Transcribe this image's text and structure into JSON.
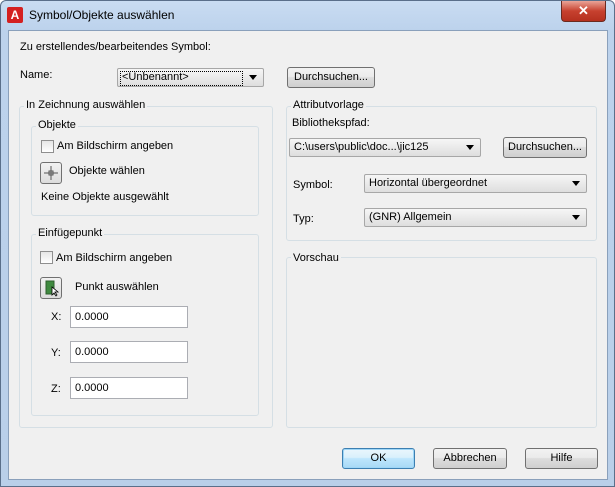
{
  "window": {
    "title": "Symbol/Objekte auswählen",
    "app_icon": "A",
    "close": "✕"
  },
  "top": {
    "symbol_heading": "Zu erstellendes/bearbeitendes Symbol:",
    "name_label": "Name:",
    "name_value": "<Unbenannt>",
    "browse_label": "Durchsuchen..."
  },
  "select_in_drawing": {
    "title": "In Zeichnung auswählen",
    "objects": {
      "title": "Objekte",
      "specify_on_screen": "Am Bildschirm angeben",
      "select_objects": "Objekte wählen",
      "status": "Keine Objekte ausgewählt"
    },
    "insertion_point": {
      "title": "Einfügepunkt",
      "specify_on_screen": "Am Bildschirm angeben",
      "pick_point": "Punkt auswählen",
      "x_label": "X:",
      "x_value": "0.0000",
      "y_label": "Y:",
      "y_value": "0.0000",
      "z_label": "Z:",
      "z_value": "0.0000"
    }
  },
  "attribute_template": {
    "title": "Attributvorlage",
    "library_path_label": "Bibliothekspfad:",
    "library_path_value": "C:\\users\\public\\doc...\\jic125",
    "browse_label": "Durchsuchen...",
    "symbol_label": "Symbol:",
    "symbol_value": "Horizontal übergeordnet",
    "type_label": "Typ:",
    "type_value": "(GNR) Allgemein"
  },
  "preview": {
    "title": "Vorschau"
  },
  "footer": {
    "ok": "OK",
    "cancel": "Abbrechen",
    "help": "Hilfe"
  }
}
